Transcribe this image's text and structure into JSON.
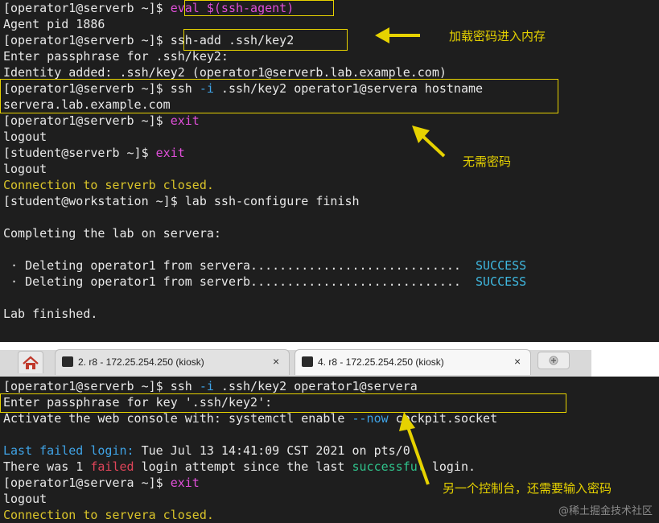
{
  "terminal_top": {
    "lines": [
      {
        "parts": [
          {
            "t": "[operator1@serverb ~]$ "
          },
          {
            "t": "eval $(ssh-agent)",
            "c": "pink"
          }
        ]
      },
      {
        "parts": [
          {
            "t": "Agent pid 1886"
          }
        ]
      },
      {
        "parts": [
          {
            "t": "[operator1@serverb ~]$ ssh-add .ssh/key2"
          }
        ]
      },
      {
        "parts": [
          {
            "t": "Enter passphrase for .ssh/key2:"
          }
        ]
      },
      {
        "parts": [
          {
            "t": "Identity added: .ssh/key2 (operator1@serverb.lab.example.com)"
          }
        ]
      },
      {
        "parts": [
          {
            "t": "[operator1@serverb ~]$ ssh "
          },
          {
            "t": "-i",
            "c": "blue"
          },
          {
            "t": " .ssh/key2 operator1@servera hostname"
          }
        ]
      },
      {
        "parts": [
          {
            "t": "servera.lab.example.com"
          }
        ]
      },
      {
        "parts": [
          {
            "t": "[operator1@serverb ~]$ "
          },
          {
            "t": "exit",
            "c": "pink"
          }
        ]
      },
      {
        "parts": [
          {
            "t": "logout"
          }
        ]
      },
      {
        "parts": [
          {
            "t": "[student@serverb ~]$ "
          },
          {
            "t": "exit",
            "c": "pink"
          }
        ]
      },
      {
        "parts": [
          {
            "t": "logout"
          }
        ]
      },
      {
        "parts": [
          {
            "t": "Connection to serverb closed.",
            "c": "yellow"
          }
        ]
      },
      {
        "parts": [
          {
            "t": "[student@workstation ~]$ lab ssh-configure finish"
          }
        ]
      },
      {
        "parts": [
          {
            "t": ""
          }
        ]
      },
      {
        "parts": [
          {
            "t": "Completing the lab on servera:"
          }
        ]
      },
      {
        "parts": [
          {
            "t": ""
          }
        ]
      },
      {
        "parts": [
          {
            "t": " · Deleting operator1 from servera.............................  "
          },
          {
            "t": "SUCCESS",
            "c": "cyan"
          }
        ]
      },
      {
        "parts": [
          {
            "t": " · Deleting operator1 from serverb.............................  "
          },
          {
            "t": "SUCCESS",
            "c": "cyan"
          }
        ]
      },
      {
        "parts": [
          {
            "t": ""
          }
        ]
      },
      {
        "parts": [
          {
            "t": "Lab finished."
          }
        ]
      }
    ]
  },
  "annotations": {
    "note_load_key": "加载密码进入内存",
    "note_no_password": "无需密码",
    "note_other_console": "另一个控制台，还需要输入密码"
  },
  "tabs": [
    {
      "label": "2. r8 - 172.25.254.250 (kiosk)",
      "active": false
    },
    {
      "label": "4. r8 - 172.25.254.250 (kiosk)",
      "active": true
    }
  ],
  "tab_close_glyph": "×",
  "icons": [
    "home-icon",
    "terminal-icon",
    "close-icon",
    "new-tab-icon"
  ],
  "terminal_bottom": {
    "lines": [
      {
        "parts": [
          {
            "t": "[operator1@serverb ~]$ ssh "
          },
          {
            "t": "-i",
            "c": "blue"
          },
          {
            "t": " .ssh/key2 operator1@servera"
          }
        ]
      },
      {
        "parts": [
          {
            "t": "Enter passphrase for key '.ssh/key2':"
          }
        ]
      },
      {
        "parts": [
          {
            "t": "Activate the web console with: systemctl enable "
          },
          {
            "t": "--now",
            "c": "blue"
          },
          {
            "t": " cockpit.socket"
          }
        ]
      },
      {
        "parts": [
          {
            "t": ""
          }
        ]
      },
      {
        "parts": [
          {
            "t": "Last failed login:",
            "c": "blue"
          },
          {
            "t": " Tue Jul 13 14:41:09 CST 2021 on pts/0"
          }
        ]
      },
      {
        "parts": [
          {
            "t": "There was 1 "
          },
          {
            "t": "failed",
            "c": "red"
          },
          {
            "t": " login attempt since the last "
          },
          {
            "t": "successful",
            "c": "green"
          },
          {
            "t": " login."
          }
        ]
      },
      {
        "parts": [
          {
            "t": "[operator1@servera ~]$ "
          },
          {
            "t": "exit",
            "c": "pink"
          }
        ]
      },
      {
        "parts": [
          {
            "t": "logout"
          }
        ]
      },
      {
        "parts": [
          {
            "t": "Connection to servera closed.",
            "c": "yellow"
          }
        ]
      }
    ]
  },
  "watermark": "@稀土掘金技术社区",
  "colors": {
    "background": "#1e1e1e",
    "text": "#e8e8e8",
    "highlight": "#e6d200",
    "pink": "#e04fd9",
    "blue": "#3fa3e6",
    "yellow": "#d9c42a",
    "red": "#e0455a",
    "green": "#2fc28b",
    "cyan": "#3fb8e0"
  }
}
